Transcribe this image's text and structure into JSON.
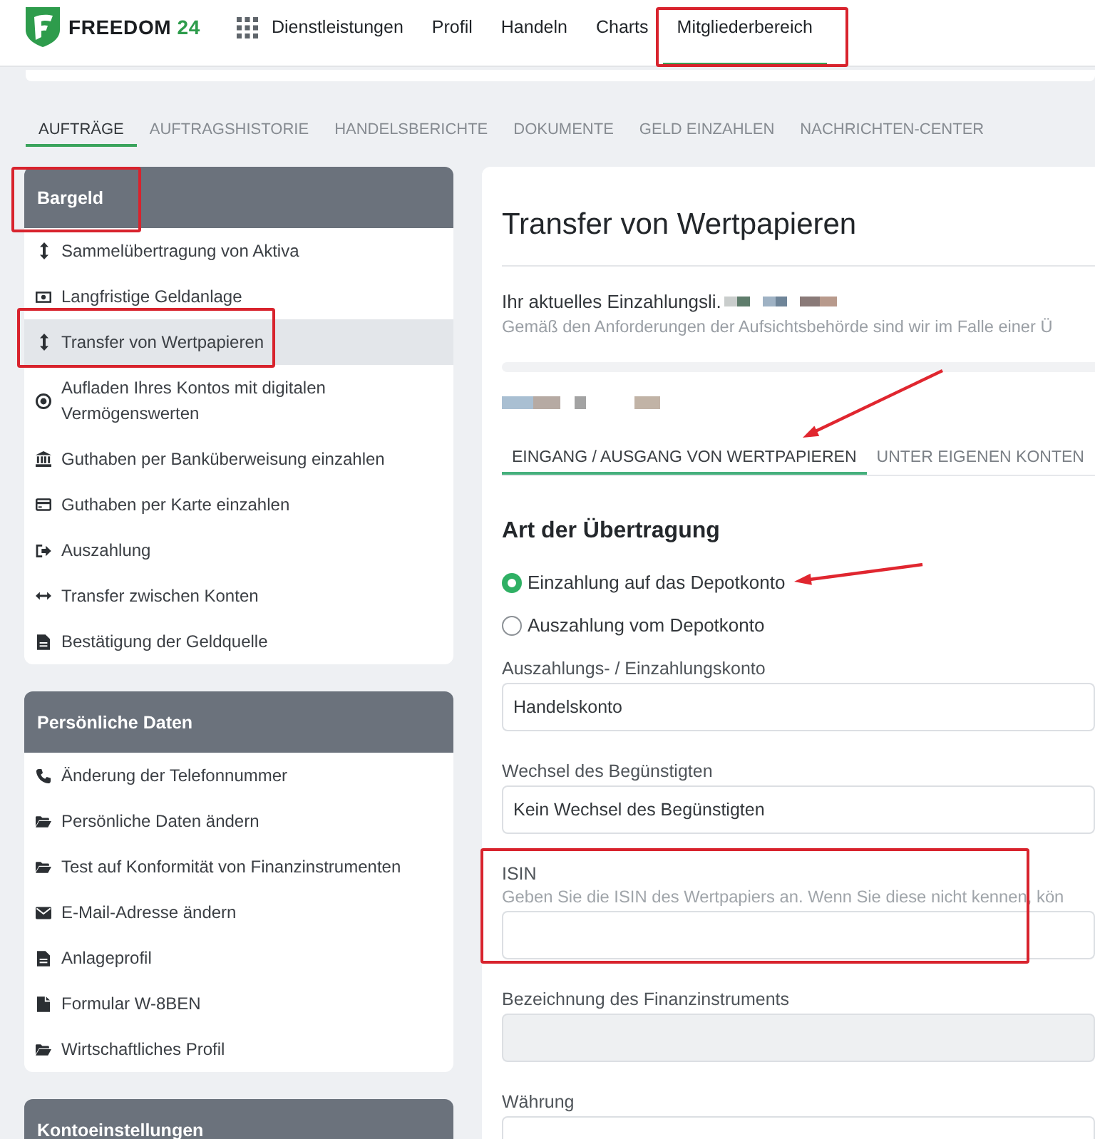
{
  "nav": {
    "logo": {
      "name": "FREEDOM",
      "number": "24"
    },
    "items": [
      {
        "label": "Dienstleistungen",
        "selected": false,
        "framed": false
      },
      {
        "label": "Profil",
        "selected": false,
        "framed": false
      },
      {
        "label": "Handeln",
        "selected": false,
        "framed": false
      },
      {
        "label": "Charts",
        "selected": false,
        "framed": false
      },
      {
        "label": "Mitgliederbereich",
        "selected": true,
        "framed": true
      }
    ]
  },
  "tabs": [
    {
      "label": "AUFTRÄGE",
      "selected": true
    },
    {
      "label": "AUFTRAGSHISTORIE",
      "selected": false
    },
    {
      "label": "HANDELSBERICHTE",
      "selected": false
    },
    {
      "label": "DOKUMENTE",
      "selected": false
    },
    {
      "label": "GELD EINZAHLEN",
      "selected": false
    },
    {
      "label": "NACHRICHTEN-CENTER",
      "selected": false
    }
  ],
  "sidebar": {
    "sections": [
      {
        "title": "Bargeld",
        "framed": true,
        "items": [
          {
            "label": "Sammelübertragung von Aktiva",
            "selected": false,
            "framed": false
          },
          {
            "label": "Langfristige Geldanlage",
            "selected": false,
            "framed": false
          },
          {
            "label": "Transfer von Wertpapieren",
            "selected": true,
            "framed": true
          },
          {
            "label": "Aufladen Ihres Kontos mit digitalen Vermögenswerten",
            "selected": false,
            "framed": false
          },
          {
            "label": "Guthaben per Banküberweisung einzahlen",
            "selected": false,
            "framed": false
          },
          {
            "label": "Guthaben per Karte einzahlen",
            "selected": false,
            "framed": false
          },
          {
            "label": "Auszahlung",
            "selected": false,
            "framed": false
          },
          {
            "label": "Transfer zwischen Konten",
            "selected": false,
            "framed": false
          },
          {
            "label": "Bestätigung der Geldquelle",
            "selected": false,
            "framed": false
          }
        ]
      },
      {
        "title": "Persönliche Daten",
        "framed": false,
        "items": [
          {
            "label": "Änderung der Telefonnummer",
            "selected": false,
            "framed": false
          },
          {
            "label": "Persönliche Daten ändern",
            "selected": false,
            "framed": false
          },
          {
            "label": "Test auf Konformität von Finanzinstrumenten",
            "selected": false,
            "framed": false
          },
          {
            "label": "E-Mail-Adresse ändern",
            "selected": false,
            "framed": false
          },
          {
            "label": "Anlageprofil",
            "selected": false,
            "framed": false
          },
          {
            "label": "Formular W-8BEN",
            "selected": false,
            "framed": false
          },
          {
            "label": "Wirtschaftliches Profil",
            "selected": false,
            "framed": false
          }
        ]
      },
      {
        "title": "Kontoeinstellungen",
        "framed": false
      }
    ]
  },
  "main": {
    "title": "Transfer von Wertpapieren",
    "notice": {
      "text": "Ihr aktuelles Einzahlungsli.",
      "masked": true,
      "note": "Gemäß den Anforderungen der Aufsichtsbehörde sind wir im Falle einer Ü"
    },
    "masked_line": true,
    "tabs": [
      {
        "label": "EINGANG / AUSGANG VON WERTPAPIEREN",
        "selected": true,
        "arrow": true
      },
      {
        "label": "UNTER EIGENEN KONTEN",
        "selected": false,
        "arrow": false
      }
    ],
    "section_title": "Art der Übertragung",
    "transfer_type": [
      {
        "label": "Einzahlung auf das Depotkonto",
        "selected": true,
        "arrow": true
      },
      {
        "label": "Auszahlung vom Depotkonto",
        "selected": false,
        "arrow": false
      }
    ],
    "fields": [
      {
        "label": "Auszahlungs- / Einzahlungskonto",
        "value": "Handelskonto",
        "disabled": false,
        "framed": false
      },
      {
        "label": "Wechsel des Begünstigten",
        "value": "Kein Wechsel des Begünstigten",
        "disabled": false,
        "framed": false
      },
      {
        "label": "ISIN",
        "hint": "Geben Sie die ISIN des Wertpapiers an. Wenn Sie diese nicht kennen, kön",
        "disabled": false,
        "framed": true
      },
      {
        "label": "Bezeichnung des Finanzinstruments",
        "disabled": true,
        "framed": false
      },
      {
        "label": "Währung",
        "disabled": false,
        "framed": false
      }
    ]
  }
}
